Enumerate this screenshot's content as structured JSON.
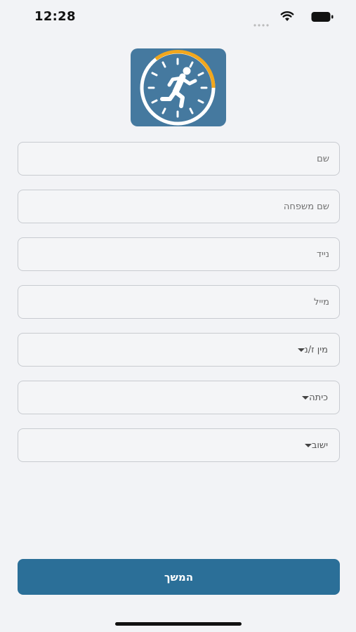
{
  "status_bar": {
    "time": "12:28",
    "icons": [
      "signal-icon",
      "wifi-icon",
      "battery-icon"
    ]
  },
  "logo": {
    "icon": "stopwatch-runner-icon",
    "colors": {
      "background": "#45799f",
      "ring": "#ffffff",
      "arc": "#f2a71d"
    }
  },
  "form": {
    "first_name_placeholder": "שם",
    "last_name_placeholder": "שם משפחה",
    "phone_placeholder": "נייד",
    "email_placeholder": "מייל",
    "gender_label": "מין ז/נ",
    "class_label": "כיתה",
    "settlement_label": "ישוב"
  },
  "continue_label": "המשך",
  "colors": {
    "accent": "#2b6f98",
    "background": "#f2f3f6",
    "border": "#c8cbd0"
  }
}
